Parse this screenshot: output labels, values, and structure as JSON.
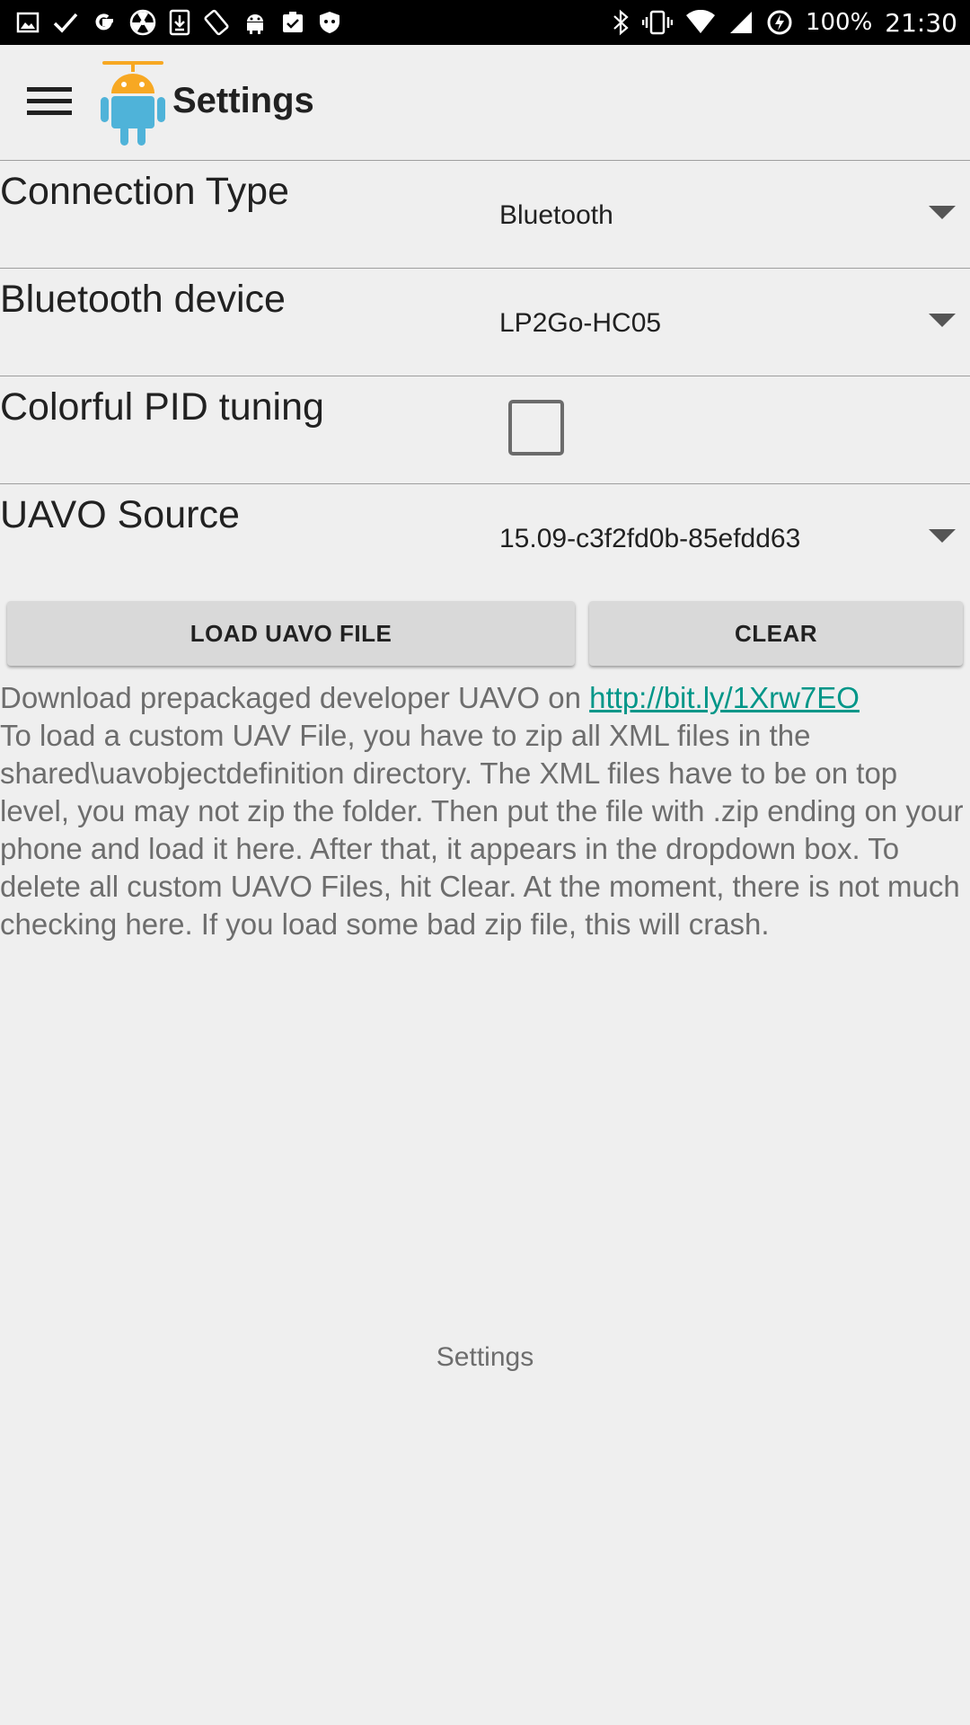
{
  "status_bar": {
    "left_icons": [
      "gallery-icon",
      "check-icon",
      "google-icon",
      "radiation-icon",
      "download-icon",
      "rotate-icon",
      "android-icon",
      "clipboard-icon",
      "shield-icon"
    ],
    "battery": "100%",
    "time": "21:30"
  },
  "toolbar": {
    "title": "Settings"
  },
  "settings": {
    "connection_type": {
      "label": "Connection Type",
      "value": "Bluetooth"
    },
    "bluetooth_device": {
      "label": "Bluetooth device",
      "value": "LP2Go-HC05"
    },
    "colorful_pid": {
      "label": "Colorful PID tuning",
      "checked": false
    },
    "uavo_source": {
      "label": "UAVO Source",
      "value": "15.09-c3f2fd0b-85efdd63"
    }
  },
  "buttons": {
    "load": "LOAD UAVO FILE",
    "clear": "CLEAR"
  },
  "info": {
    "download_prefix": "Download prepackaged developer UAVO on ",
    "download_link": "http://bit.ly/1Xrw7EO",
    "instructions": "To load a custom UAV File, you have to zip all XML files in the shared\\uavobjectdefinition directory. The XML files have to be on top level, you may not zip the folder. Then put the file with .zip ending on your phone and load it here. After that, it appears in the dropdown box. To delete all custom UAVO Files, hit Clear. At the moment, there is not much checking here. If you load some bad zip file, this will crash."
  },
  "footer": {
    "label": "Settings"
  },
  "colors": {
    "accent": "#009688",
    "background": "#efefef",
    "logo_blue": "#4fb3d9",
    "logo_orange": "#f7a823"
  }
}
